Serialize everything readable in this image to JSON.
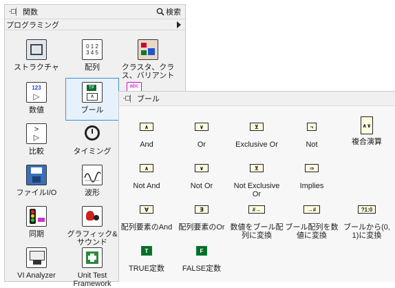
{
  "palette": {
    "title": "関数",
    "search_label": "検索",
    "category": "プログラミング",
    "items": [
      {
        "label": "ストラクチャ",
        "icon": "structure-icon"
      },
      {
        "label": "配列",
        "icon": "array-icon"
      },
      {
        "label": "クラスタ、クラス、バリアント",
        "icon": "cluster-icon"
      },
      {
        "label": "数値",
        "icon": "numeric-icon"
      },
      {
        "label": "ブール",
        "icon": "boolean-icon"
      },
      {
        "label": "比較",
        "icon": "comparison-icon"
      },
      {
        "label": "タイミング",
        "icon": "timing-icon"
      },
      {
        "label": "ファイルI/O",
        "icon": "file-io-icon"
      },
      {
        "label": "波形",
        "icon": "waveform-icon"
      },
      {
        "label": "同期",
        "icon": "synchronization-icon"
      },
      {
        "label": "グラフィック&サウンド",
        "icon": "graphics-sound-icon"
      },
      {
        "label": "VI Analyzer",
        "icon": "vi-analyzer-icon"
      },
      {
        "label": "Unit Test Framework",
        "icon": "unit-test-icon"
      }
    ]
  },
  "boolean_palette": {
    "title": "ブール",
    "items": [
      {
        "label": "And",
        "glyph": "∧"
      },
      {
        "label": "Or",
        "glyph": "∨"
      },
      {
        "label": "Exclusive Or",
        "glyph": "⊻"
      },
      {
        "label": "Not",
        "glyph": "¬"
      },
      {
        "label": "複合演算",
        "glyph": "∧∨"
      },
      {
        "label": "Not And",
        "glyph": "∧"
      },
      {
        "label": "Not Or",
        "glyph": "∨"
      },
      {
        "label": "Not Exclusive Or",
        "glyph": "⊻"
      },
      {
        "label": "Implies",
        "glyph": "⇒"
      },
      {
        "label": "配列要素のAnd",
        "glyph": "∀"
      },
      {
        "label": "配列要素のOr",
        "glyph": "∃"
      },
      {
        "label": "数値をブール配列に変換",
        "glyph": "#→"
      },
      {
        "label": "ブール配列を数値に変換",
        "glyph": "→#"
      },
      {
        "label": "ブールから(0, 1)に変換",
        "glyph": "?1:0"
      },
      {
        "label": "TRUE定数",
        "glyph": "T"
      },
      {
        "label": "FALSE定数",
        "glyph": "F"
      }
    ]
  }
}
